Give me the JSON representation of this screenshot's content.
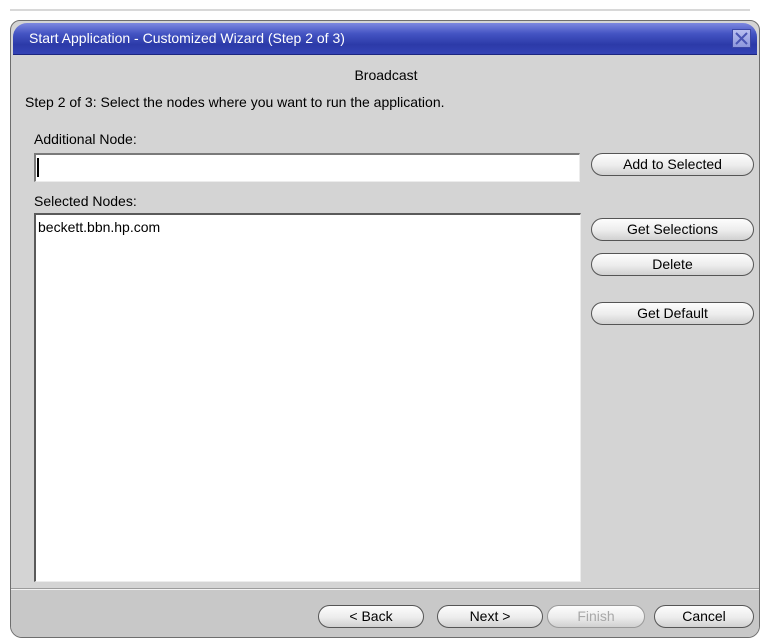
{
  "window": {
    "title": "Start Application - Customized Wizard (Step 2 of 3)"
  },
  "header": {
    "heading": "Broadcast",
    "instructions": "Step 2 of 3: Select the nodes where you want to run the application."
  },
  "additional_node": {
    "label": "Additional Node:",
    "value": "",
    "add_button": "Add to Selected"
  },
  "selected_nodes": {
    "label": "Selected Nodes:",
    "items": [
      "beckett.bbn.hp.com"
    ]
  },
  "side_buttons": {
    "get_selections": "Get Selections",
    "delete": "Delete",
    "get_default": "Get Default"
  },
  "footer": {
    "back": "< Back",
    "next": "Next >",
    "finish": "Finish",
    "cancel": "Cancel"
  },
  "icons": {
    "close": "close-icon"
  },
  "colors": {
    "titlebar": "#3443b6",
    "dialog_bg": "#d4d4d4"
  }
}
